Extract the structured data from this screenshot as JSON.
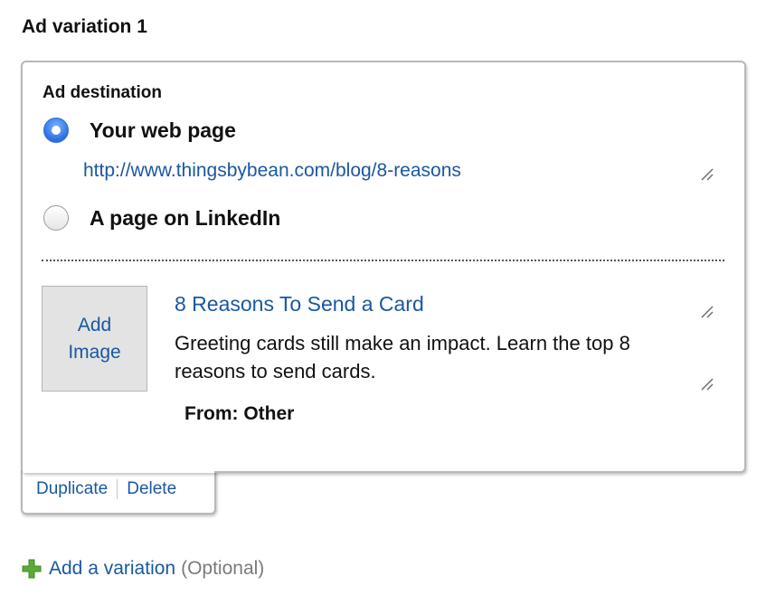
{
  "section": {
    "title": "Ad variation 1"
  },
  "destination": {
    "label": "Ad destination",
    "options": [
      {
        "label": "Your web page",
        "selected": true
      },
      {
        "label": "A page on LinkedIn",
        "selected": false
      }
    ],
    "url_value": "http://www.thingsbybean.com/blog/8-reasons"
  },
  "ad": {
    "image_button": {
      "line1": "Add",
      "line2": "Image"
    },
    "headline": "8 Reasons To Send a Card",
    "description": "Greeting cards still make an impact. Learn the top 8 reasons to send cards.",
    "from": "From: Other"
  },
  "tab_actions": {
    "duplicate": "Duplicate",
    "delete": "Delete"
  },
  "footer": {
    "add_variation": "Add a variation",
    "optional": "(Optional)"
  },
  "colors": {
    "link": "#1a58a0",
    "radio_selected": "#2a6fe0",
    "plus_icon": "#5aab3a"
  }
}
